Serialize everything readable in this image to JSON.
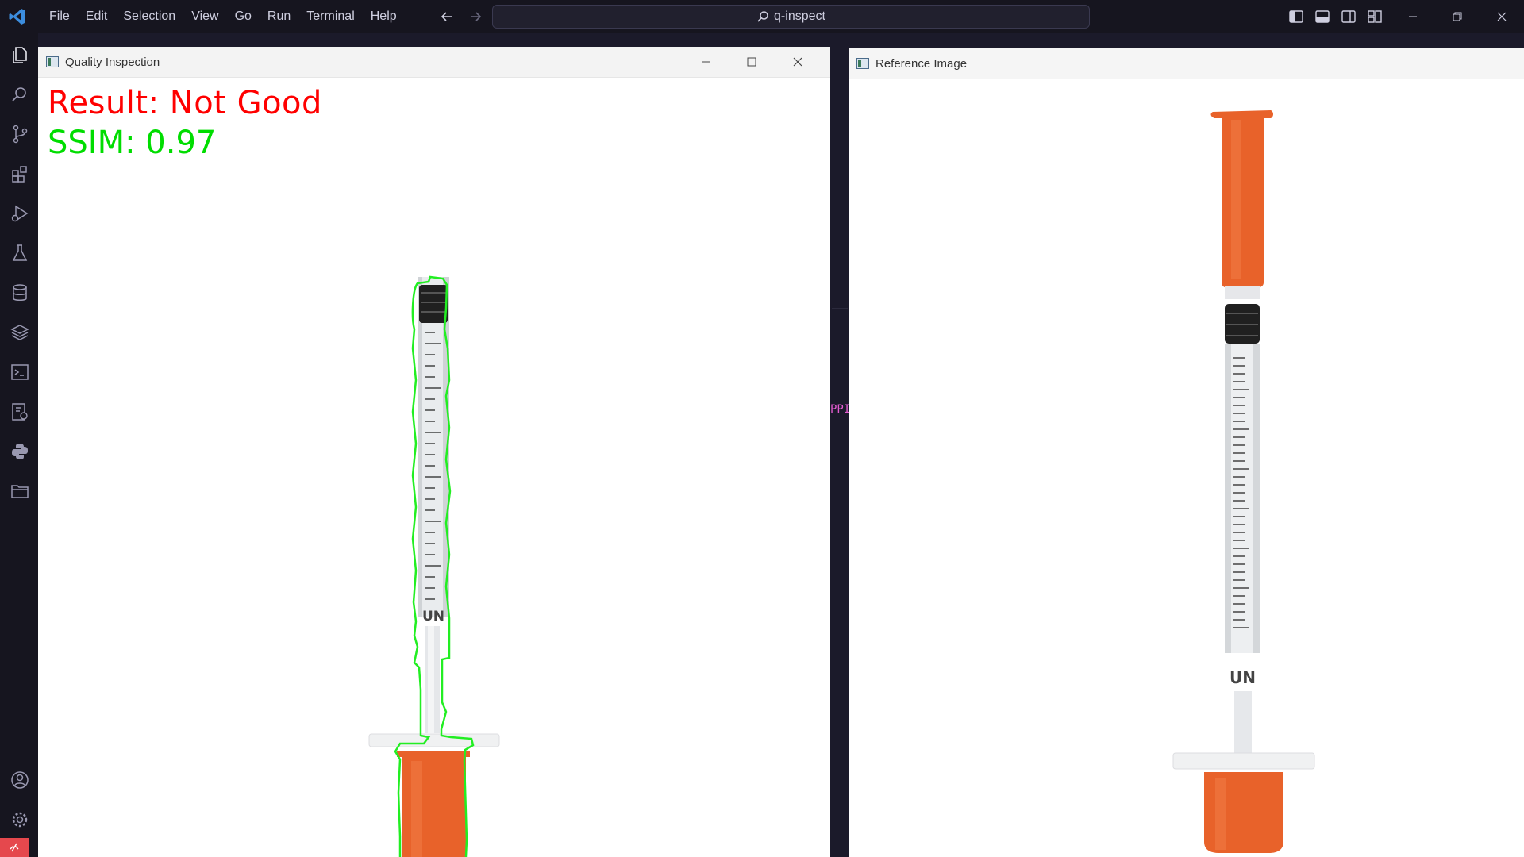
{
  "menu": [
    "File",
    "Edit",
    "Selection",
    "View",
    "Go",
    "Run",
    "Terminal",
    "Help"
  ],
  "search": {
    "text": "q-inspect"
  },
  "inspection_window": {
    "title": "Quality Inspection",
    "result_text": "Result: Not Good",
    "ssim_text": "SSIM: 0.97",
    "result_color": "#ff0000",
    "ssim_color": "#00dd00",
    "barrel_label": "UN"
  },
  "reference_window": {
    "title": "Reference Image",
    "barrel_label": "UN"
  },
  "background_text": {
    "pink_fragment": "PPI"
  },
  "colors": {
    "accent": "#3c8dde",
    "syringe_orange": "#e8622a",
    "contour_green": "#22ee22",
    "remote_indicator": "#e5484d"
  },
  "icons": {
    "activity_bar": [
      "explorer-icon",
      "search-icon",
      "source-control-icon",
      "extensions-icon",
      "run-debug-icon",
      "testing-icon",
      "database-icon",
      "layers-icon",
      "terminal-icon",
      "remote-explorer-icon",
      "python-icon",
      "folder-icon",
      "account-icon",
      "settings-gear-icon"
    ]
  }
}
